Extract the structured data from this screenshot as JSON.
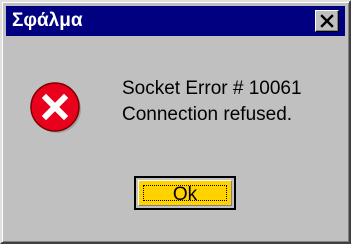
{
  "window": {
    "title": "Σφάλμα",
    "close_icon": "close-icon"
  },
  "message": {
    "icon": "error-icon",
    "line1": "Socket Error # 10061",
    "line2": "Connection refused."
  },
  "buttons": {
    "ok_label": "Ok"
  },
  "colors": {
    "title_bar": "#000080",
    "dialog_bg": "#c0c0c0",
    "error_icon": "#e8001c",
    "ok_button_bg": "#ffd200"
  }
}
